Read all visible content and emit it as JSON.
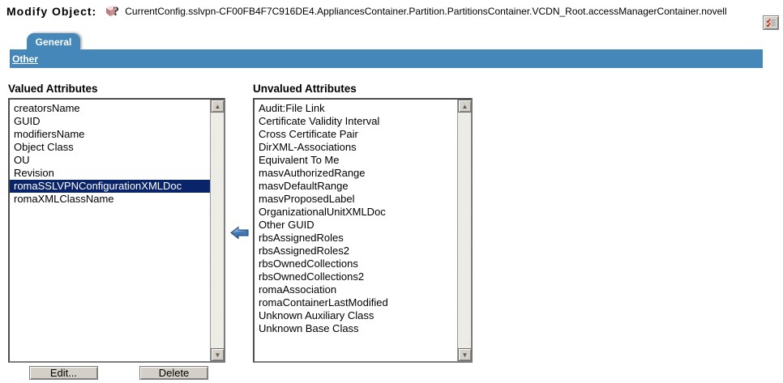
{
  "header": {
    "title": "Modify Object:",
    "object_path": "CurrentConfig.sslvpn-CF00FB4F7C916DE4.AppliancesContainer.Partition.PartitionsContainer.VCDN_Root.accessManagerContainer.novell"
  },
  "tabs": {
    "general_label": "General",
    "other_label": "Other"
  },
  "valued_attributes": {
    "label": "Valued Attributes",
    "items": [
      "creatorsName",
      "GUID",
      "modifiersName",
      "Object Class",
      "OU",
      "Revision",
      "romaSSLVPNConfigurationXMLDoc",
      "romaXMLClassName"
    ],
    "selected_index": 6,
    "selected_item": "romaSSLVPNConfigurationXMLDoc"
  },
  "unvalued_attributes": {
    "label": "Unvalued Attributes",
    "items": [
      "Audit:File Link",
      "Certificate Validity Interval",
      "Cross Certificate Pair",
      "DirXML-Associations",
      "Equivalent To Me",
      "masvAuthorizedRange",
      "masvDefaultRange",
      "masvProposedLabel",
      "OrganizationalUnitXMLDoc",
      "Other GUID",
      "rbsAssignedRoles",
      "rbsAssignedRoles2",
      "rbsOwnedCollections",
      "rbsOwnedCollections2",
      "romaAssociation",
      "romaContainerLastModified",
      "Unknown Auxiliary Class",
      "Unknown Base Class"
    ]
  },
  "buttons": {
    "edit_label": "Edit...",
    "delete_label": "Delete"
  },
  "scrollbar": {
    "up_glyph": "▲",
    "down_glyph": "▼"
  },
  "colors": {
    "tab_blue": "#4587B8",
    "selection_navy": "#0A246A",
    "arrow_blue": "#4178B4",
    "button_face": "#d4d0c8"
  }
}
